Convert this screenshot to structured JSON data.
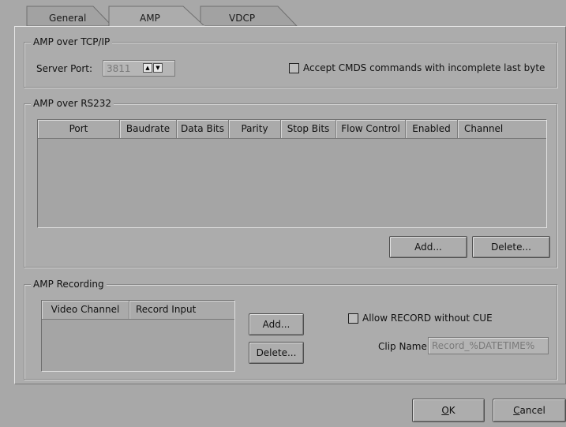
{
  "tabs": [
    {
      "label": "General"
    },
    {
      "label": "AMP"
    },
    {
      "label": "VDCP"
    }
  ],
  "tcp": {
    "title": "AMP over TCP/IP",
    "server_port_label": "Server Port:",
    "server_port_value": "3811",
    "accept_cmds_label": "Accept CMDS commands with incomplete last byte",
    "accept_cmds_checked": false
  },
  "rs232": {
    "title": "AMP over RS232",
    "columns": [
      "Port",
      "Baudrate",
      "Data Bits",
      "Parity",
      "Stop Bits",
      "Flow Control",
      "Enabled",
      "Channel"
    ],
    "rows": [],
    "add_label": "Add...",
    "delete_label": "Delete..."
  },
  "recording": {
    "title": "AMP Recording",
    "columns": [
      "Video Channel",
      "Record Input"
    ],
    "rows": [],
    "add_label": "Add...",
    "delete_label": "Delete...",
    "allow_record_label": "Allow RECORD without CUE",
    "allow_record_checked": false,
    "clip_name_label": "Clip Name:",
    "clip_name_value": "Record_%DATETIME%"
  },
  "footer": {
    "ok_label": "OK",
    "ok_mnemonic": "O",
    "ok_rest": "K",
    "cancel_label": "Cancel",
    "cancel_mnemonic": "C",
    "cancel_rest": "ancel"
  }
}
